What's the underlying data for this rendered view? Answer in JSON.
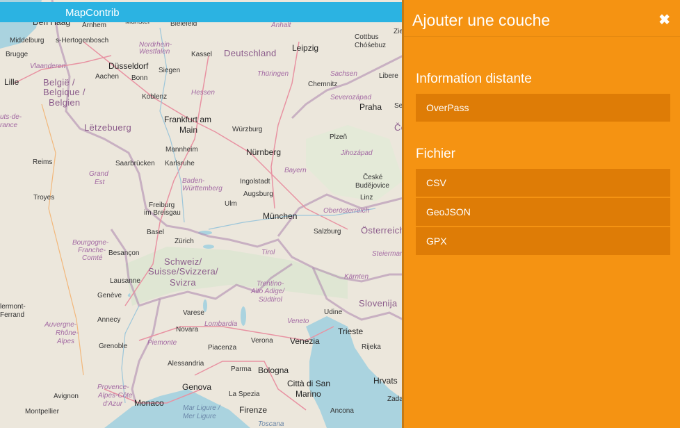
{
  "app": {
    "title": "MapContrib"
  },
  "panel": {
    "title": "Ajouter une couche",
    "close_icon": "close-icon",
    "sections": [
      {
        "title": "Information distante",
        "items": [
          "OverPass"
        ]
      },
      {
        "title": "Fichier",
        "items": [
          "CSV",
          "GeoJSON",
          "GPX"
        ]
      }
    ]
  },
  "map": {
    "labels": [
      "Den Haag",
      "Arnhem",
      "Münster",
      "Bielefeld",
      "Anhalt",
      "Cottbus",
      "Chóśebuz",
      "Zie",
      "Middelburg",
      "s-Hertogenbosch",
      "Nordrhein-",
      "Westfalen",
      "Kassel",
      "Deutschland",
      "Leipzig",
      "Brugge",
      "Vlaanderen",
      "Düsseldorf",
      "Siegen",
      "Thüringen",
      "Sachsen",
      "Libere",
      "Lille",
      "Aachen",
      "Bonn",
      "Hessen",
      "Chemnitz",
      "België /",
      "Belgique /",
      "Belgien",
      "Koblenz",
      "Severozápad",
      "Praha",
      "Se",
      "uts-de-",
      "rance",
      "Frankfurt am",
      "Main",
      "Lëtzebuerg",
      "Würzburg",
      "Plzeň",
      "Če",
      "Mannheim",
      "Nürnberg",
      "Jihozápad",
      "Reims",
      "Saarbrücken",
      "Karlsruhe",
      "Grand",
      "Est",
      "Bayern",
      "Baden-",
      "Württemberg",
      "Ingolstadt",
      "České",
      "Budějovice",
      "Troyes",
      "Augsburg",
      "Ulm",
      "Linz",
      "Freiburg",
      "im Breisgau",
      "Oberösterreich",
      "München",
      "Basel",
      "Salzburg",
      "Österreich",
      "Zürich",
      "Bourgogne-",
      "Franche-",
      "Comté",
      "Besançon",
      "Tirol",
      "Steiermar",
      "Schweiz/",
      "Suisse/Svizzera/",
      "Svizra",
      "Kärnten",
      "Lausanne",
      "Trentino-",
      "Alto Adige/",
      "Südtirol",
      "Genève",
      "Slovenija",
      "lermont-",
      "Ferrand",
      "Varese",
      "Udine",
      "Annecy",
      "Lombardia",
      "Veneto",
      "Novara",
      "Auvergne-",
      "Rhône-",
      "Alpes",
      "Trieste",
      "Verona",
      "Venezia",
      "Piemonte",
      "Grenoble",
      "Piacenza",
      "Rijeka",
      "Alessandria",
      "Parma",
      "Bologna",
      "Hrvats",
      "Genova",
      "Città di San",
      "Marino",
      "Provence-",
      "Alpes-Côte",
      "d'Azur",
      "Avignon",
      "La Spezia",
      "Zada",
      "Monaco",
      "Montpellier",
      "Mar Ligure /",
      "Mer Ligure",
      "Firenze",
      "Ancona",
      "Toscana"
    ]
  }
}
